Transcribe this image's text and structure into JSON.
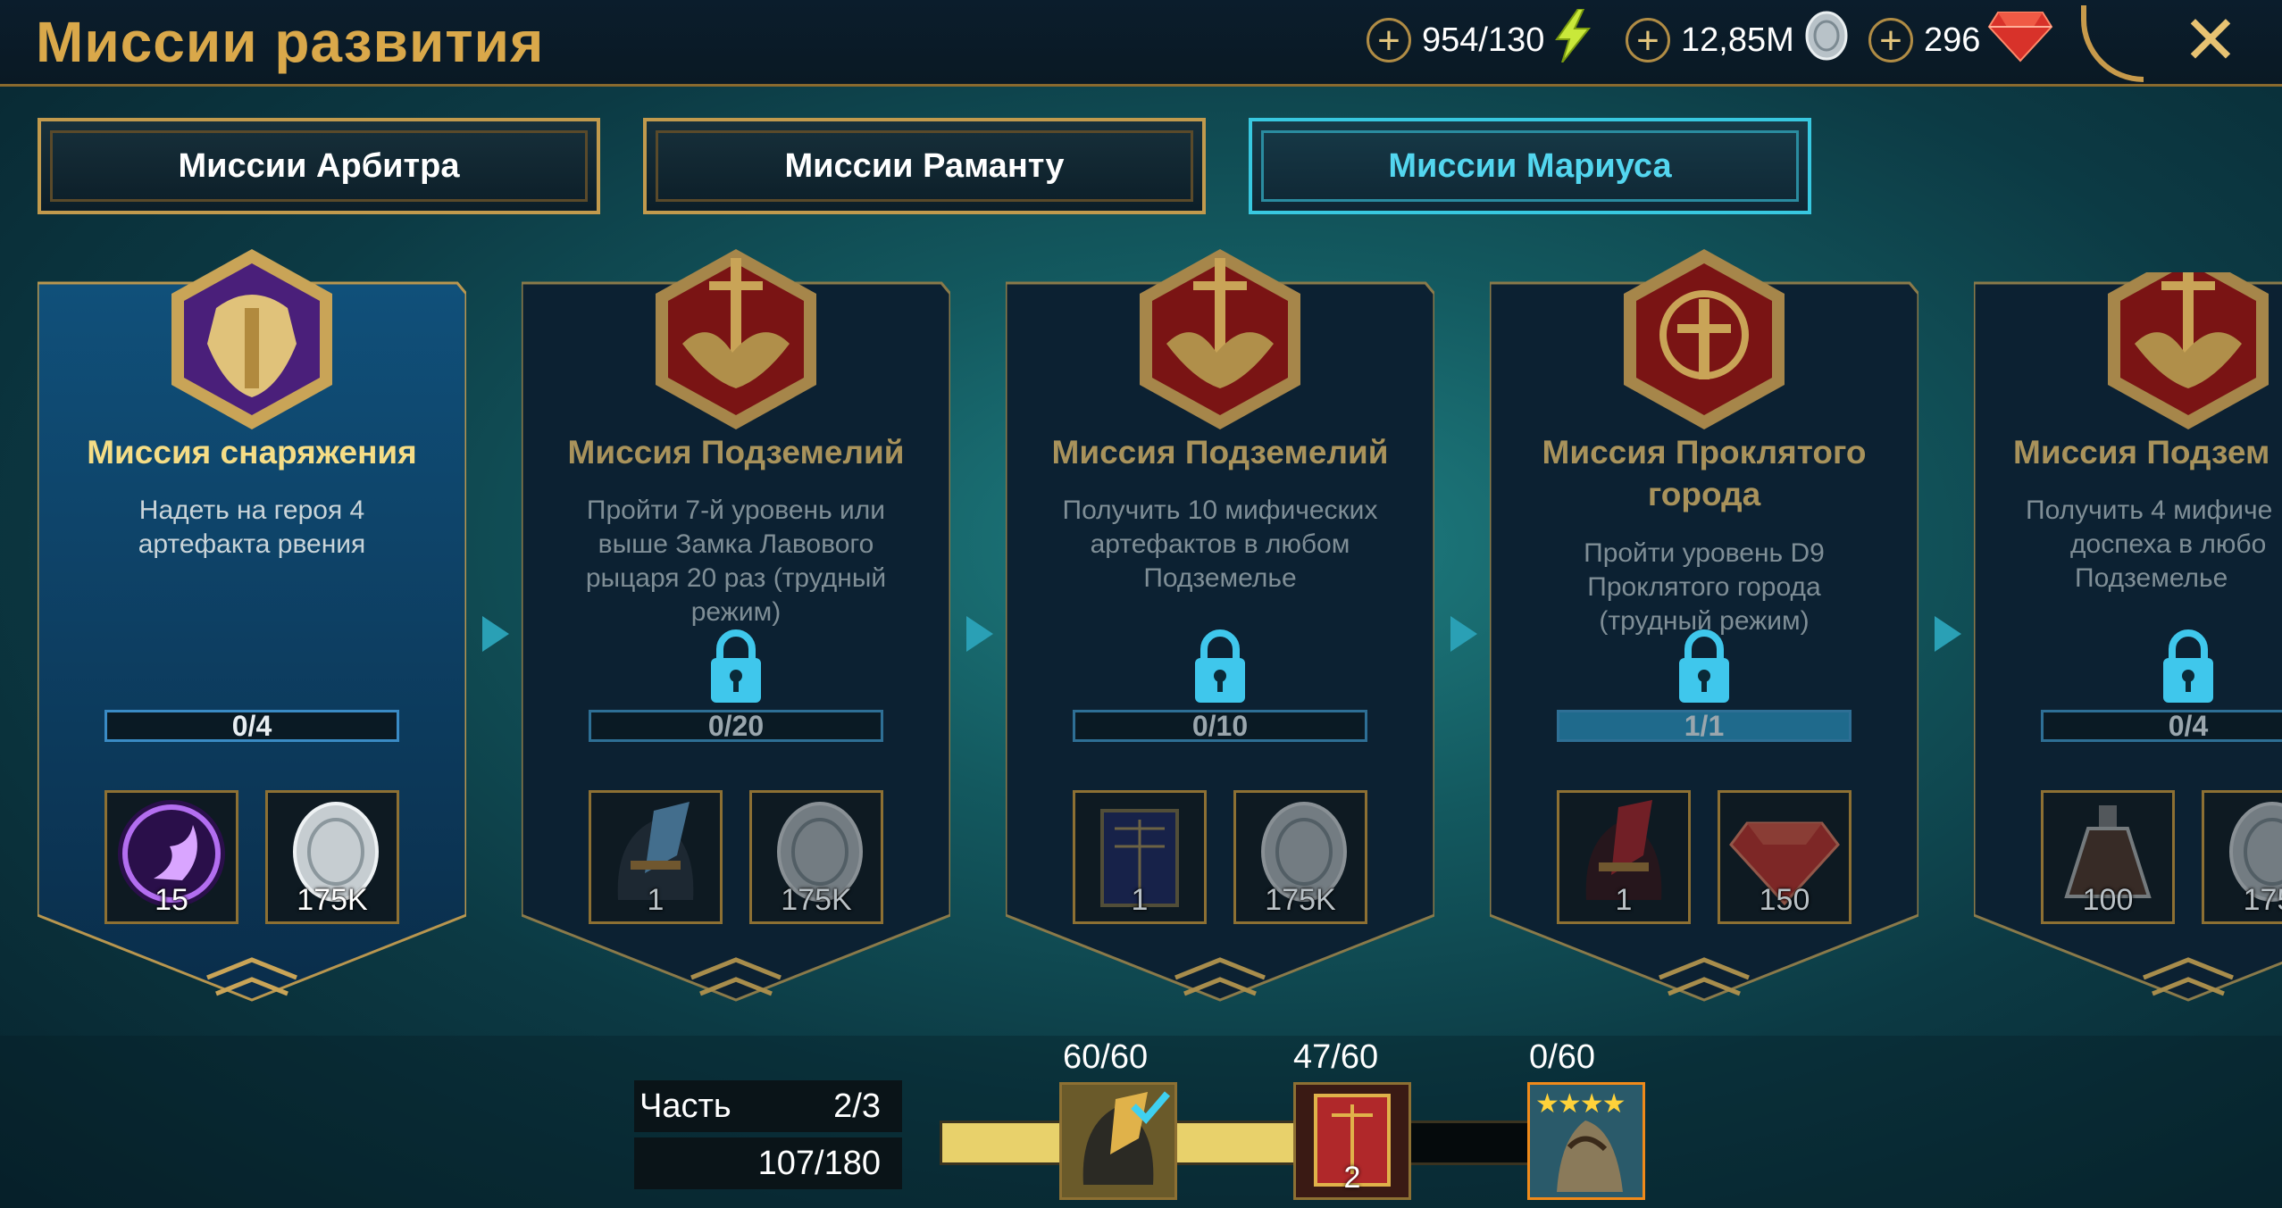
{
  "header": {
    "title": "Миссии развития",
    "resources": [
      {
        "name": "energy",
        "value": "954/130",
        "icon": "lightning-icon"
      },
      {
        "name": "silver",
        "value": "12,85M",
        "icon": "silver-coin-icon"
      },
      {
        "name": "gems",
        "value": "296",
        "icon": "ruby-icon"
      }
    ],
    "close_icon": "close-icon"
  },
  "tabs": [
    {
      "label": "Миссии Арбитра",
      "active": false
    },
    {
      "label": "Миссии Раманту",
      "active": false
    },
    {
      "label": "Миссии Мариуса",
      "active": true
    }
  ],
  "missions": [
    {
      "title_lines": [
        "Миссия снаряжения"
      ],
      "desc_lines": [
        "Надеть на героя 4",
        "артефакта рвения"
      ],
      "progress": "0/4",
      "progress_fraction": 0,
      "locked": false,
      "emblem": "armor-emblem-icon",
      "rewards": [
        {
          "icon": "purple-fragment-icon",
          "amount": "15"
        },
        {
          "icon": "silver-coin-icon",
          "amount": "175K"
        }
      ]
    },
    {
      "title_lines": [
        "Миссия Подземелий"
      ],
      "desc_lines": [
        "Пройти 7-й уровень или",
        "выше Замка Лавового",
        "рыцаря 20 раз (трудный",
        "режим)"
      ],
      "progress": "0/20",
      "progress_fraction": 0,
      "locked": true,
      "emblem": "dungeon-emblem-icon",
      "rewards": [
        {
          "icon": "helmet-artifact-icon",
          "amount": "1"
        },
        {
          "icon": "silver-coin-icon",
          "amount": "175K"
        }
      ]
    },
    {
      "title_lines": [
        "Миссия Подземелий"
      ],
      "desc_lines": [
        "Получить 10 мифических",
        "артефактов в любом",
        "Подземелье"
      ],
      "progress": "0/10",
      "progress_fraction": 0,
      "locked": true,
      "emblem": "dungeon-emblem-icon",
      "rewards": [
        {
          "icon": "tome-icon",
          "amount": "1"
        },
        {
          "icon": "silver-coin-icon",
          "amount": "175K"
        }
      ]
    },
    {
      "title_lines": [
        "Миссия Проклятого",
        "города"
      ],
      "desc_lines": [
        "Пройти уровень D9",
        "Проклятого города",
        "(трудный режим)"
      ],
      "progress": "1/1",
      "progress_fraction": 1,
      "locked": true,
      "emblem": "cursed-city-emblem-icon",
      "rewards": [
        {
          "icon": "red-helmet-artifact-icon",
          "amount": "1"
        },
        {
          "icon": "ruby-icon",
          "amount": "150"
        }
      ]
    },
    {
      "title_lines": [
        "Миссия Подзем"
      ],
      "desc_lines": [
        "Получить 4 мифиче",
        "доспеха в любо",
        "Подземелье"
      ],
      "progress": "0/4",
      "progress_fraction": 0,
      "locked": true,
      "emblem": "dungeon-emblem-icon",
      "rewards": [
        {
          "icon": "potion-icon",
          "amount": "100"
        },
        {
          "icon": "silver-coin-icon",
          "amount": "175"
        }
      ]
    }
  ],
  "footer": {
    "part_label": "Часть",
    "part_value": "2/3",
    "points": "107/180",
    "points_fraction": 0.594,
    "stages": [
      {
        "label": "60/60",
        "icon": "helmet-artifact-icon",
        "amount": "",
        "done": true
      },
      {
        "label": "47/60",
        "icon": "tome-icon",
        "amount": "2",
        "done": false
      },
      {
        "label": "0/60",
        "icon": "champion-portrait-icon",
        "amount": "",
        "done": false,
        "stars": 4
      }
    ]
  },
  "colors": {
    "gold": "#d9a84a",
    "active_tab": "#53d6ef",
    "progress_fill": "#e8d16b",
    "lock": "#3fc7ec"
  }
}
